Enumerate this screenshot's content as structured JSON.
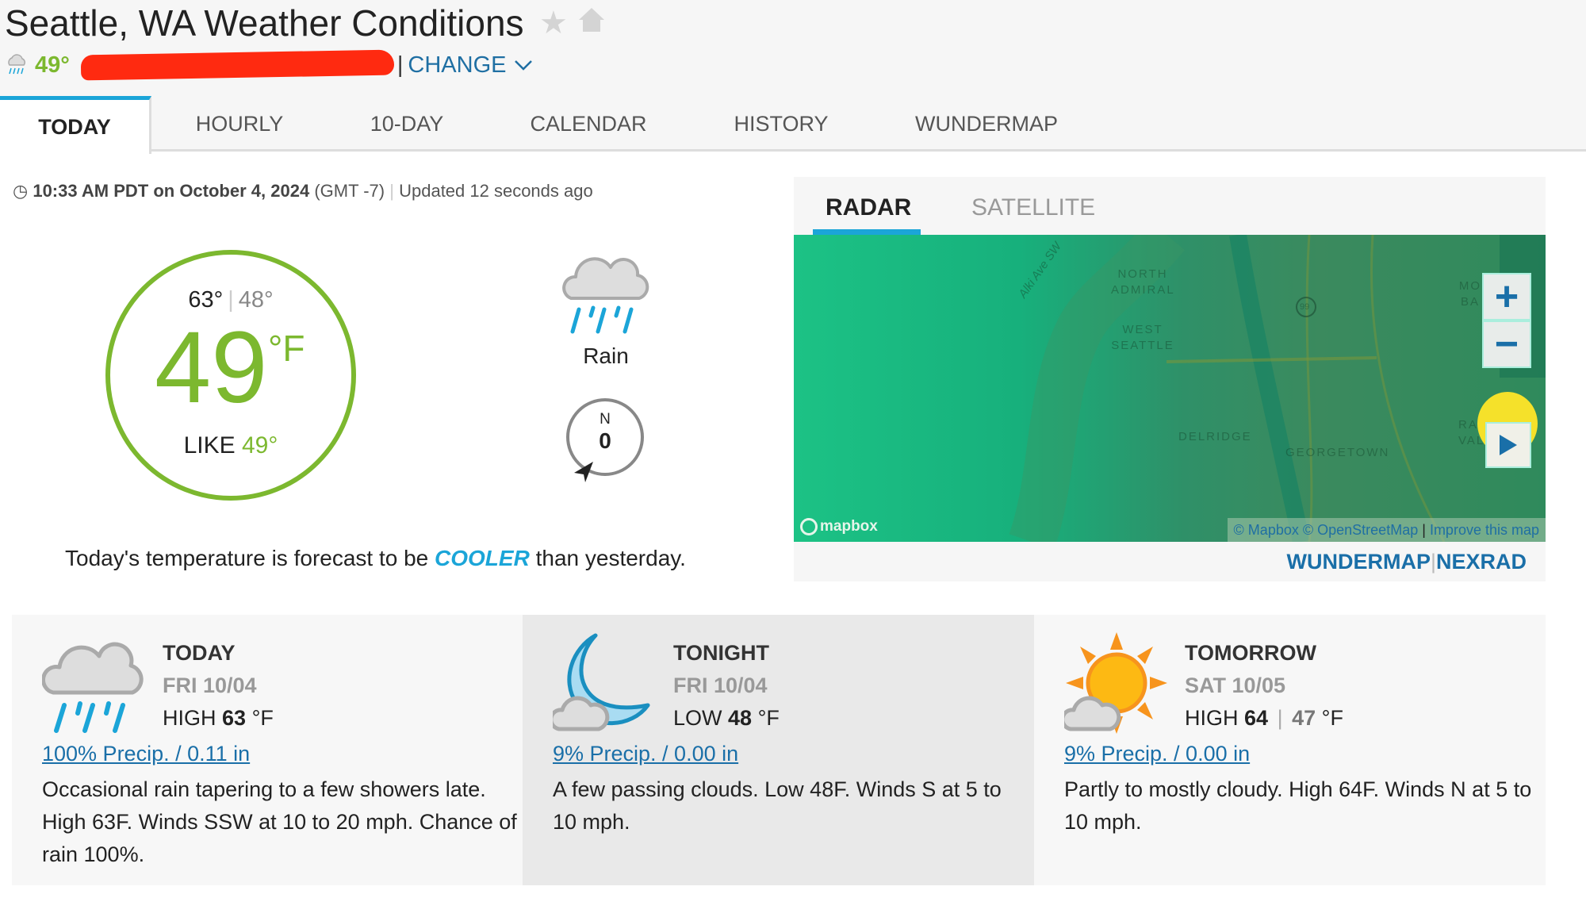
{
  "header": {
    "title": "Seattle, WA Weather Conditions",
    "current_temp": "49°",
    "change_label": "CHANGE",
    "separator": "|"
  },
  "tabs": [
    {
      "label": "TODAY",
      "active": true
    },
    {
      "label": "HOURLY"
    },
    {
      "label": "10-DAY"
    },
    {
      "label": "CALENDAR"
    },
    {
      "label": "HISTORY"
    },
    {
      "label": "WUNDERMAP"
    }
  ],
  "timestamp": {
    "time": "10:33 AM PDT on October 4, 2024",
    "tz": "(GMT -7)",
    "sep": "|",
    "updated": "Updated 12 seconds ago"
  },
  "current": {
    "high": "63°",
    "sep": "|",
    "low": "48°",
    "temp": "49",
    "unit": "°F",
    "like_label": "LIKE",
    "like_value": "49°",
    "condition": "Rain",
    "wind_dir": "N",
    "wind_speed": "0"
  },
  "comparison": {
    "prefix": "Today's temperature is forecast to be",
    "word": "COOLER",
    "suffix": "than yesterday."
  },
  "radar": {
    "tabs": [
      "RADAR",
      "SATELLITE"
    ],
    "map_labels": [
      "NORTH ADMIRAL",
      "WEST SEATTLE",
      "DELRIDGE",
      "GEORGETOWN",
      "Alki Ave SW",
      "99",
      "MO BA",
      "RAI VAL"
    ],
    "mapbox": "mapbox",
    "attribution": {
      "mapbox": "© Mapbox",
      "osm": "© OpenStreetMap",
      "sep": "|",
      "improve": "Improve this map"
    },
    "zoom_in": "+",
    "zoom_out": "−",
    "links": {
      "wundermap": "WUNDERMAP",
      "sep": "|",
      "nexrad": "NEXRAD"
    }
  },
  "forecast": [
    {
      "title": "TODAY",
      "date": "FRI 10/04",
      "kind": "HIGH",
      "value": "63",
      "unit": "°F",
      "precip": "100% Precip. / 0.11 in",
      "desc": "Occasional rain tapering to a few showers late. High 63F. Winds SSW at 10 to 20 mph. Chance of rain 100%.",
      "icon": "rain-icon"
    },
    {
      "title": "TONIGHT",
      "date": "FRI 10/04",
      "kind": "LOW",
      "value": "48",
      "unit": "°F",
      "precip": "9% Precip. / 0.00 in",
      "desc": "A few passing clouds. Low 48F. Winds S at 5 to 10 mph.",
      "icon": "moon-cloud-icon"
    },
    {
      "title": "TOMORROW",
      "date": "SAT 10/05",
      "kind": "HIGH",
      "value": "64",
      "sep": "|",
      "low": "47",
      "unit": "°F",
      "precip": "9% Precip. / 0.00 in",
      "desc": "Partly to mostly cloudy. High 64F. Winds N at 5 to 10 mph.",
      "icon": "sun-cloud-icon"
    }
  ],
  "colors": {
    "accent_green": "#7cb82f",
    "accent_blue": "#1ba5d8",
    "link": "#1a6fa8"
  }
}
